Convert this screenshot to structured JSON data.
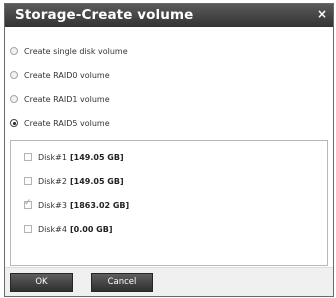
{
  "dialog": {
    "title": "Storage-Create volume",
    "close_glyph": "×"
  },
  "volume_options": [
    {
      "label": "Create single disk volume",
      "selected": false
    },
    {
      "label": "Create RAID0 volume",
      "selected": false
    },
    {
      "label": "Create RAID1 volume",
      "selected": false
    },
    {
      "label": "Create RAID5 volume",
      "selected": true
    }
  ],
  "disks": [
    {
      "name": "Disk#1",
      "size": "[149.05 GB]",
      "checked": false
    },
    {
      "name": "Disk#2",
      "size": "[149.05 GB]",
      "checked": false
    },
    {
      "name": "Disk#3",
      "size": "[1863.02 GB]",
      "checked": true
    },
    {
      "name": "Disk#4",
      "size": "[0.00 GB]",
      "checked": false
    }
  ],
  "buttons": {
    "ok_label": "OK",
    "cancel_label": "Cancel"
  }
}
